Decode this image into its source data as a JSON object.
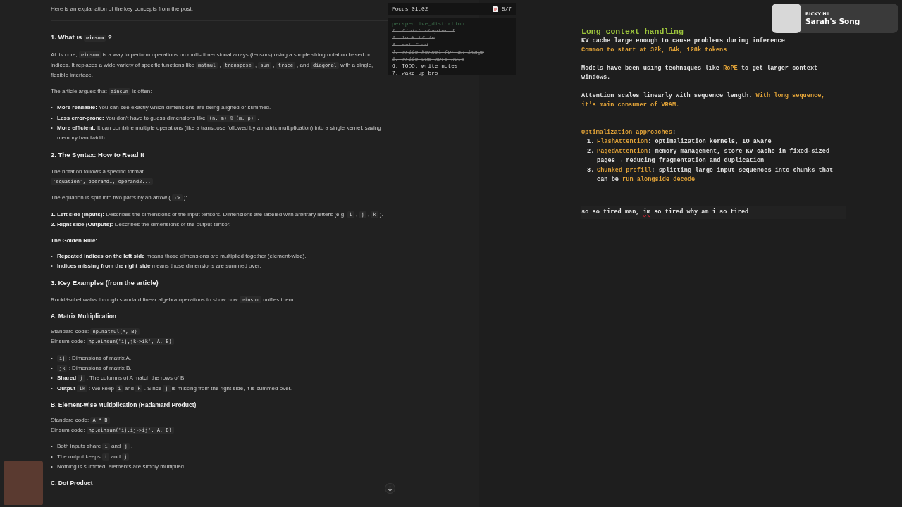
{
  "article": {
    "blocks": [
      {
        "kind": "p",
        "parts": [
          {
            "kind": "text",
            "text": "Here is an explanation of the key concepts from the post."
          }
        ]
      },
      {
        "kind": "rule"
      },
      {
        "kind": "h2",
        "parts": [
          {
            "kind": "text",
            "text": "1. What is "
          },
          {
            "kind": "code",
            "text": "einsum"
          },
          {
            "kind": "text",
            "text": " ?"
          }
        ]
      },
      {
        "kind": "p",
        "parts": [
          {
            "kind": "text",
            "text": "At its core, "
          },
          {
            "kind": "code",
            "text": "einsum"
          },
          {
            "kind": "text",
            "text": " is a way to perform operations on multi-dimensional arrays (tensors) using a simple string notation based on indices. It replaces a wide variety of specific functions like "
          },
          {
            "kind": "code",
            "text": "matmul"
          },
          {
            "kind": "text",
            "text": " , "
          },
          {
            "kind": "code",
            "text": "transpose"
          },
          {
            "kind": "text",
            "text": " , "
          },
          {
            "kind": "code",
            "text": "sum"
          },
          {
            "kind": "text",
            "text": " , "
          },
          {
            "kind": "code",
            "text": "trace"
          },
          {
            "kind": "text",
            "text": " , and "
          },
          {
            "kind": "code",
            "text": "diagonal"
          },
          {
            "kind": "text",
            "text": " with a single, flexible interface."
          }
        ]
      },
      {
        "kind": "p",
        "parts": [
          {
            "kind": "text",
            "text": "The article argues that "
          },
          {
            "kind": "code",
            "text": "einsum"
          },
          {
            "kind": "text",
            "text": " is often:"
          }
        ]
      },
      {
        "kind": "ul",
        "marker": "•",
        "items": [
          [
            {
              "kind": "bold",
              "text": "More readable:"
            },
            {
              "kind": "text",
              "text": " You can see exactly which dimensions are being aligned or summed."
            }
          ],
          [
            {
              "kind": "bold",
              "text": "Less error-prone:"
            },
            {
              "kind": "text",
              "text": " You don't have to guess dimensions like "
            },
            {
              "kind": "code",
              "text": "(n, m) @ (m, p)"
            },
            {
              "kind": "text",
              "text": " ."
            }
          ],
          [
            {
              "kind": "bold",
              "text": "More efficient:"
            },
            {
              "kind": "text",
              "text": " It can combine multiple operations (like a transpose followed by a matrix multiplication) into a single kernel, saving memory bandwidth."
            }
          ]
        ]
      },
      {
        "kind": "h2",
        "parts": [
          {
            "kind": "text",
            "text": "2. The Syntax: How to Read It"
          }
        ]
      },
      {
        "kind": "line",
        "parts": [
          {
            "kind": "text",
            "text": "The notation follows a specific format:"
          }
        ]
      },
      {
        "kind": "p",
        "parts": [
          {
            "kind": "code",
            "text": "'equation', operand1, operand2..."
          }
        ]
      },
      {
        "kind": "p",
        "parts": [
          {
            "kind": "text",
            "text": "The equation is split into two parts by an arrow ( "
          },
          {
            "kind": "code",
            "text": "->"
          },
          {
            "kind": "text",
            "text": " ):"
          }
        ]
      },
      {
        "kind": "line",
        "parts": [
          {
            "kind": "bold",
            "text": "1. Left side (Inputs):"
          },
          {
            "kind": "text",
            "text": " Describes the dimensions of the input tensors. Dimensions are labeled with arbitrary letters (e.g. "
          },
          {
            "kind": "code",
            "text": "i"
          },
          {
            "kind": "text",
            "text": " , "
          },
          {
            "kind": "code",
            "text": "j"
          },
          {
            "kind": "text",
            "text": " , "
          },
          {
            "kind": "code",
            "text": "k"
          },
          {
            "kind": "text",
            "text": " )."
          }
        ]
      },
      {
        "kind": "p",
        "parts": [
          {
            "kind": "bold",
            "text": "2. Right side (Outputs):"
          },
          {
            "kind": "text",
            "text": " Describes the dimensions of the output tensor."
          }
        ]
      },
      {
        "kind": "label",
        "parts": [
          {
            "kind": "text",
            "text": "The Golden Rule:"
          }
        ]
      },
      {
        "kind": "ul",
        "marker": "•",
        "items": [
          [
            {
              "kind": "bold",
              "text": "Repeated indices on the left side"
            },
            {
              "kind": "text",
              "text": " means those dimensions are multiplied together (element-wise)."
            }
          ],
          [
            {
              "kind": "bold",
              "text": "Indices missing from the right side"
            },
            {
              "kind": "text",
              "text": " means those dimensions are summed over."
            }
          ]
        ]
      },
      {
        "kind": "h2",
        "parts": [
          {
            "kind": "text",
            "text": "3. Key Examples (from the article)"
          }
        ]
      },
      {
        "kind": "p",
        "parts": [
          {
            "kind": "text",
            "text": "Rocktäschel walks through standard linear algebra operations to show how "
          },
          {
            "kind": "code",
            "text": "einsum"
          },
          {
            "kind": "text",
            "text": " unifies them."
          }
        ]
      },
      {
        "kind": "h3",
        "parts": [
          {
            "kind": "text",
            "text": "A. Matrix Multiplication"
          }
        ]
      },
      {
        "kind": "line",
        "parts": [
          {
            "kind": "text",
            "text": "Standard code: "
          },
          {
            "kind": "code",
            "text": "np.matmul(A, B)"
          }
        ]
      },
      {
        "kind": "p",
        "parts": [
          {
            "kind": "text",
            "text": "Einsum code: "
          },
          {
            "kind": "code",
            "text": "np.einsum('ij,jk->ik', A, B)"
          }
        ]
      },
      {
        "kind": "ul",
        "marker": "•",
        "items": [
          [
            {
              "kind": "code",
              "text": "ij"
            },
            {
              "kind": "text",
              "text": " : Dimensions of matrix A."
            }
          ],
          [
            {
              "kind": "code",
              "text": "jk"
            },
            {
              "kind": "text",
              "text": " : Dimensions of matrix B."
            }
          ],
          [
            {
              "kind": "bold",
              "text": "Shared "
            },
            {
              "kind": "code",
              "text": "j"
            },
            {
              "kind": "text",
              "text": " : The columns of A match the rows of B."
            }
          ],
          [
            {
              "kind": "bold",
              "text": "Output "
            },
            {
              "kind": "code",
              "text": "ik"
            },
            {
              "kind": "text",
              "text": " : We keep "
            },
            {
              "kind": "code",
              "text": "i"
            },
            {
              "kind": "text",
              "text": " and "
            },
            {
              "kind": "code",
              "text": "k"
            },
            {
              "kind": "text",
              "text": " . Since "
            },
            {
              "kind": "code",
              "text": "j"
            },
            {
              "kind": "text",
              "text": " is missing from the right side, it is summed over."
            }
          ]
        ]
      },
      {
        "kind": "h3",
        "parts": [
          {
            "kind": "text",
            "text": "B. Element-wise Multiplication (Hadamard Product)"
          }
        ]
      },
      {
        "kind": "line",
        "parts": [
          {
            "kind": "text",
            "text": "Standard code: "
          },
          {
            "kind": "code",
            "text": "A * B"
          }
        ]
      },
      {
        "kind": "p",
        "parts": [
          {
            "kind": "text",
            "text": "Einsum code: "
          },
          {
            "kind": "code",
            "text": "np.einsum('ij,ij->ij', A, B)"
          }
        ]
      },
      {
        "kind": "ul",
        "marker": "•",
        "items": [
          [
            {
              "kind": "text",
              "text": "Both inputs share "
            },
            {
              "kind": "code",
              "text": "i"
            },
            {
              "kind": "text",
              "text": " and "
            },
            {
              "kind": "code",
              "text": "j"
            },
            {
              "kind": "text",
              "text": " ."
            }
          ],
          [
            {
              "kind": "text",
              "text": "The output keeps "
            },
            {
              "kind": "code",
              "text": "i"
            },
            {
              "kind": "text",
              "text": " and "
            },
            {
              "kind": "code",
              "text": "j"
            },
            {
              "kind": "text",
              "text": " ."
            }
          ],
          [
            {
              "kind": "text",
              "text": "Nothing is summed; elements are simply multiplied."
            }
          ]
        ]
      },
      {
        "kind": "h3",
        "parts": [
          {
            "kind": "text",
            "text": "C. Dot Product"
          }
        ]
      }
    ]
  },
  "focus": {
    "title": "Focus 01:02",
    "count": "5/7",
    "file": "perspective_distortion",
    "tasks": [
      {
        "text": "1. finish chapter 4",
        "done": true
      },
      {
        "text": "2. lock tf in",
        "done": true
      },
      {
        "text": "3. eat food",
        "done": true
      },
      {
        "text": "4. write kernel for an image",
        "done": true
      },
      {
        "text": "5. write one more note",
        "done": true
      },
      {
        "text": "6. TODO: write notes",
        "done": false
      },
      {
        "text": "7. wake up bro",
        "done": false
      }
    ]
  },
  "notes": {
    "lines": [
      {
        "kind": "heading",
        "parts": [
          {
            "kind": "plain",
            "text": "Long context handling"
          }
        ]
      },
      {
        "kind": "line",
        "parts": [
          {
            "kind": "plain",
            "text": "KV cache large enough to cause problems during inference"
          }
        ]
      },
      {
        "kind": "line",
        "parts": [
          {
            "kind": "accent",
            "text": "Common to start at 32k, 64k, 128k tokens"
          }
        ]
      },
      {
        "kind": "blank"
      },
      {
        "kind": "line",
        "parts": [
          {
            "kind": "plain",
            "text": "Models have been using techniques like "
          },
          {
            "kind": "accent",
            "text": "RoPE"
          },
          {
            "kind": "plain",
            "text": " to get larger context windows."
          }
        ]
      },
      {
        "kind": "blank"
      },
      {
        "kind": "line",
        "parts": [
          {
            "kind": "plain",
            "text": "Attention scales linearly with sequence length. "
          },
          {
            "kind": "accent",
            "text": "With long sequence, it's main consumer of VRAM."
          }
        ]
      },
      {
        "kind": "blank"
      },
      {
        "kind": "blank"
      },
      {
        "kind": "line",
        "parts": [
          {
            "kind": "accent",
            "text": "Optimalization approaches"
          },
          {
            "kind": "plain",
            "text": ":"
          }
        ]
      },
      {
        "kind": "list",
        "items": [
          {
            "number": "1.",
            "parts": [
              {
                "kind": "accent",
                "text": "FlashAttention"
              },
              {
                "kind": "plain",
                "text": ": optimalization kernels, IO aware"
              }
            ]
          },
          {
            "number": "2.",
            "parts": [
              {
                "kind": "accent",
                "text": "PagedAttention"
              },
              {
                "kind": "plain",
                "text": ": memory management, store KV cache in fixed-sized pages → reducing fragmentation and duplication"
              }
            ]
          },
          {
            "number": "3.",
            "parts": [
              {
                "kind": "accent",
                "text": "Chunked prefill"
              },
              {
                "kind": "plain",
                "text": ": splitting large input sequences into chunks that can be "
              },
              {
                "kind": "accent",
                "text": "run alongside decode"
              }
            ]
          }
        ]
      }
    ],
    "input": [
      {
        "text": "so so tired man, ",
        "misspelled": false
      },
      {
        "text": "im",
        "misspelled": true
      },
      {
        "text": " so tired why am i so tired",
        "misspelled": false
      }
    ]
  },
  "now_playing": {
    "artist": "RICKY HIL",
    "title": "Sarah's Song"
  }
}
